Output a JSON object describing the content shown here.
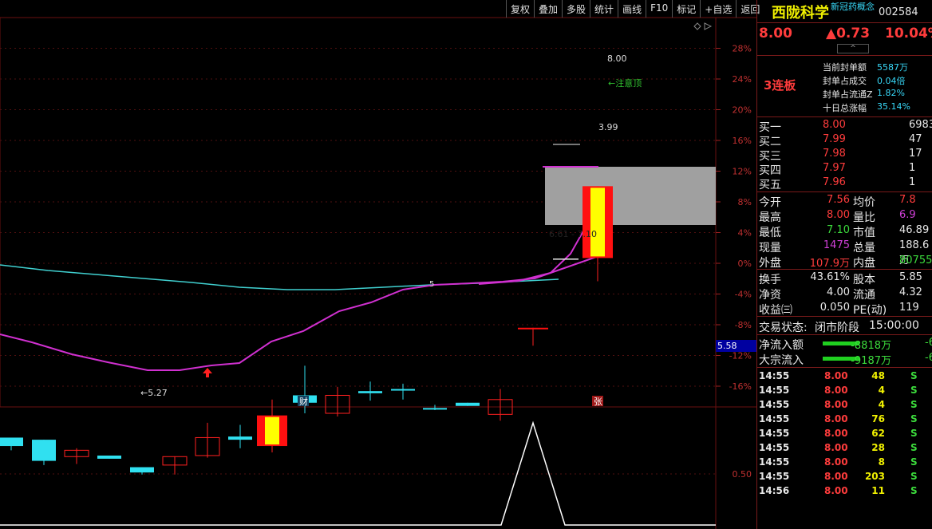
{
  "toolbar": [
    "复权",
    "叠加",
    "多股",
    "统计",
    "画线",
    "F10",
    "标记",
    "+自选",
    "返回"
  ],
  "stock": {
    "name": "西陇科学",
    "concept": "新冠药概念",
    "code": "002584",
    "price": "8.00",
    "change": "▲0.73",
    "change_pct": "10.04%",
    "streak": "3连板"
  },
  "seal": [
    {
      "label": "当前封单额",
      "value": "5587万"
    },
    {
      "label": "封单占成交",
      "value": "0.04倍"
    },
    {
      "label": "封单占流通Z",
      "value": "1.82%"
    },
    {
      "label": "十日总涨幅",
      "value": "35.14%"
    }
  ],
  "order_book": [
    {
      "label": "买一",
      "price": "8.00",
      "vol": "6983"
    },
    {
      "label": "买二",
      "price": "7.99",
      "vol": "47"
    },
    {
      "label": "买三",
      "price": "7.98",
      "vol": "17"
    },
    {
      "label": "买四",
      "price": "7.97",
      "vol": "1"
    },
    {
      "label": "买五",
      "price": "7.96",
      "vol": "1"
    }
  ],
  "stats": [
    {
      "l1": "今开",
      "v1": "7.56",
      "l2": "均价",
      "v2": "7.8"
    },
    {
      "l1": "最高",
      "v1": "8.00",
      "l2": "量比",
      "v2": "6.9"
    },
    {
      "l1": "最低",
      "v1": "7.10",
      "l2": "市值",
      "v2": "46.89"
    },
    {
      "l1": "现量",
      "v1": "1475",
      "l2": "总量",
      "v2": "188.6万"
    },
    {
      "l1": "外盘",
      "v1": "107.9万",
      "l2": "内盘",
      "v2": "80755"
    }
  ],
  "stats2": [
    {
      "l1": "换手",
      "v1": "43.61%",
      "l2": "股本",
      "v2": "5.85"
    },
    {
      "l1": "净资",
      "v1": "4.00",
      "l2": "流通",
      "v2": "4.32"
    },
    {
      "l1": "收益㈢",
      "v1": "0.050",
      "l2": "PE(动)",
      "v2": "119"
    }
  ],
  "trade_status": {
    "label": "交易状态:",
    "status": "闭市阶段",
    "time": "15:00:00"
  },
  "flows": [
    {
      "label": "净流入额",
      "value": "-8818万",
      "extra": "-6"
    },
    {
      "label": "大宗流入",
      "value": "-9187万",
      "extra": "-6"
    }
  ],
  "ticks": [
    {
      "time": "14:55",
      "price": "8.00",
      "vol": "48",
      "side": "S"
    },
    {
      "time": "14:55",
      "price": "8.00",
      "vol": "4",
      "side": "S"
    },
    {
      "time": "14:55",
      "price": "8.00",
      "vol": "4",
      "side": "S"
    },
    {
      "time": "14:55",
      "price": "8.00",
      "vol": "76",
      "side": "S"
    },
    {
      "time": "14:55",
      "price": "8.00",
      "vol": "62",
      "side": "S"
    },
    {
      "time": "14:55",
      "price": "8.00",
      "vol": "28",
      "side": "S"
    },
    {
      "time": "14:55",
      "price": "8.00",
      "vol": "8",
      "side": "S"
    },
    {
      "time": "14:55",
      "price": "8.00",
      "vol": "203",
      "side": "S"
    },
    {
      "time": "14:56",
      "price": "8.00",
      "vol": "11",
      "side": "S"
    }
  ],
  "chart_labels": {
    "pct_ticks": [
      "28%",
      "24%",
      "20%",
      "16%",
      "12%",
      "8%",
      "4%",
      "0%",
      "-4%",
      "-8%",
      "-12%",
      "-16%"
    ],
    "price_badge": "5.58",
    "sub_tick": "0.50",
    "low_label": "←5.27",
    "high_label": "8.00",
    "high_note": "←注意顶",
    "gap_price": "3.99",
    "gap_range": "6.61 - 7.10",
    "mark_cai": "财",
    "mark_zhang": "张",
    "mark_dot": "5"
  },
  "colors": {
    "up": "#ff2020",
    "down": "#30e0f0",
    "ma_cyan": "#40d0d0",
    "ma_magenta": "#d030d0",
    "gap_box": "#a0a0a0"
  },
  "chart_data": {
    "type": "candlestick",
    "series": [
      {
        "o": 5.62,
        "h": 5.62,
        "l": 5.5,
        "c": 5.54
      },
      {
        "o": 5.6,
        "h": 5.6,
        "l": 5.36,
        "c": 5.4
      },
      {
        "o": 5.44,
        "h": 5.52,
        "l": 5.37,
        "c": 5.5
      },
      {
        "o": 5.45,
        "h": 5.45,
        "l": 5.42,
        "c": 5.42
      },
      {
        "o": 5.34,
        "h": 5.34,
        "l": 5.27,
        "c": 5.29
      },
      {
        "o": 5.36,
        "h": 5.44,
        "l": 5.27,
        "c": 5.44
      },
      {
        "o": 5.45,
        "h": 5.76,
        "l": 5.43,
        "c": 5.62
      },
      {
        "o": 5.63,
        "h": 5.74,
        "l": 5.52,
        "c": 5.6
      },
      {
        "o": 5.54,
        "h": 5.98,
        "l": 5.48,
        "c": 5.83
      },
      {
        "o": 6.02,
        "h": 6.3,
        "l": 5.85,
        "c": 5.95
      },
      {
        "o": 5.85,
        "h": 6.1,
        "l": 5.82,
        "c": 6.02
      },
      {
        "o": 6.06,
        "h": 6.15,
        "l": 5.97,
        "c": 6.04
      },
      {
        "o": 6.08,
        "h": 6.13,
        "l": 5.98,
        "c": 6.07
      },
      {
        "o": 5.9,
        "h": 5.93,
        "l": 5.88,
        "c": 5.89
      },
      {
        "o": 5.95,
        "h": 5.95,
        "l": 5.92,
        "c": 5.92
      },
      {
        "o": 5.84,
        "h": 6.08,
        "l": 5.78,
        "c": 5.98
      },
      {
        "o": 6.65,
        "h": 6.66,
        "l": 6.49,
        "c": 6.66
      },
      {
        "o": 7.31,
        "h": 7.31,
        "l": 7.31,
        "c": 7.31
      },
      {
        "o": 7.32,
        "h": 8.0,
        "l": 7.1,
        "c": 8.0
      }
    ]
  }
}
